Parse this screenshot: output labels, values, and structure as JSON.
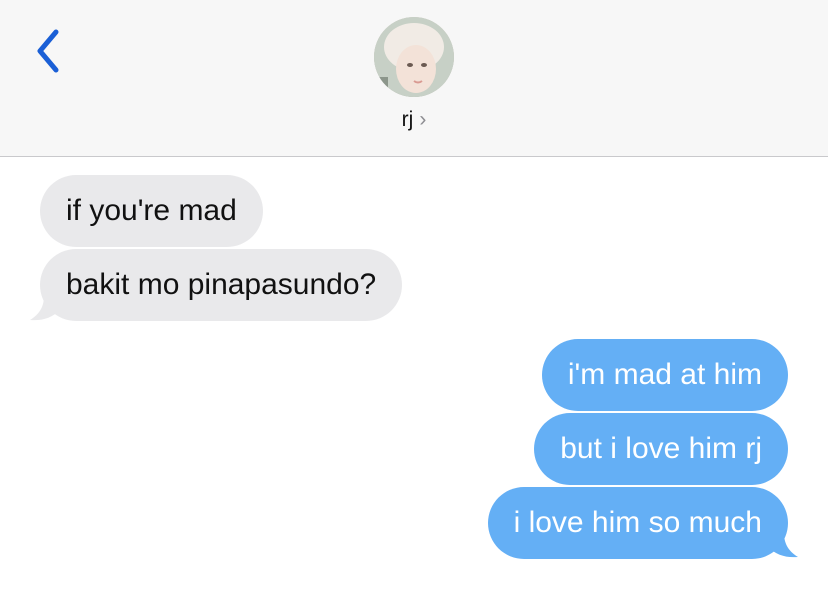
{
  "header": {
    "contact_name": "rj",
    "chevron": "›",
    "back_icon": "chevron-left-icon",
    "accent_color": "#1a5fd6"
  },
  "messages": {
    "received": [
      {
        "text": "if you're mad"
      },
      {
        "text": "bakit mo pinapasundo?"
      }
    ],
    "sent": [
      {
        "text": "i'm mad at him"
      },
      {
        "text": "but i love him rj"
      },
      {
        "text": "i love him so much"
      }
    ]
  },
  "colors": {
    "received_bubble": "#e9e9eb",
    "sent_bubble": "#64aff5"
  }
}
